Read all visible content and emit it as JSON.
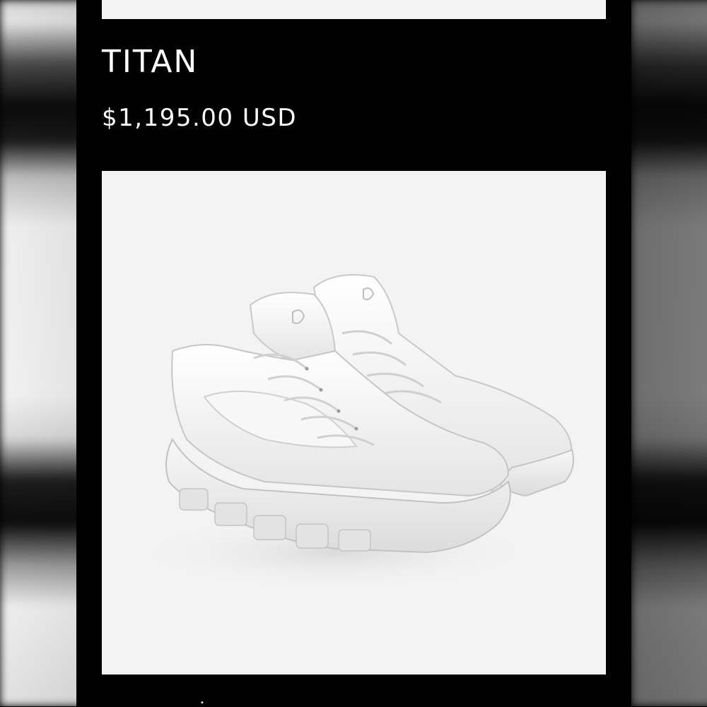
{
  "product": {
    "name": "TITAN",
    "price": "$1,195.00 USD",
    "image_subject": "white high-top leather sneakers pair"
  },
  "colors": {
    "background": "#000000",
    "card": "#f3f3f3",
    "text": "#ffffff"
  }
}
